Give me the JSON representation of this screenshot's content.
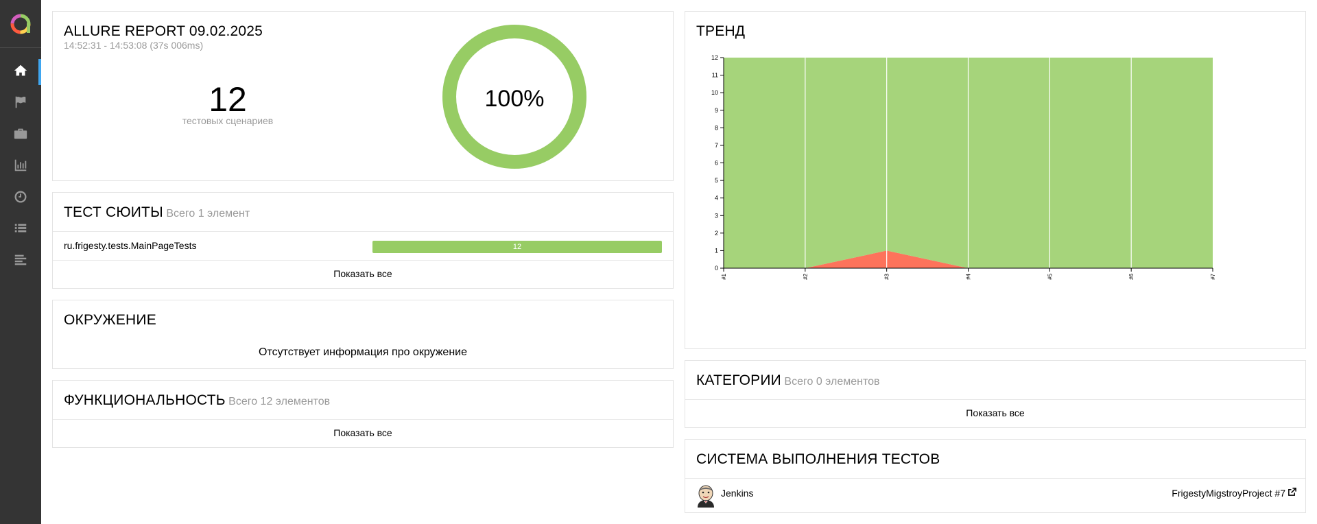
{
  "sidebar": {
    "logo": "allure-logo-icon",
    "items": [
      {
        "icon": "home-icon",
        "active": true
      },
      {
        "icon": "flag-icon",
        "active": false
      },
      {
        "icon": "briefcase-icon",
        "active": false
      },
      {
        "icon": "bar-chart-icon",
        "active": false
      },
      {
        "icon": "clock-icon",
        "active": false
      },
      {
        "icon": "list-icon",
        "active": false
      },
      {
        "icon": "timeline-icon",
        "active": false
      }
    ]
  },
  "summary": {
    "title": "ALLURE REPORT 09.02.2025",
    "time_range": "14:52:31 - 14:53:08 (37s 006ms)",
    "count": "12",
    "count_label": "тестовых сценариев",
    "percent": "100%",
    "passed_fraction": 1.0,
    "ring_color": "#97cc64"
  },
  "suites": {
    "title": "ТЕСТ СЮИТЫ",
    "subtitle": "Всего 1 элемент",
    "rows": [
      {
        "name": "ru.frigesty.tests.MainPageTests",
        "count": "12",
        "passed_fraction": 1.0
      }
    ],
    "show_all": "Показать все"
  },
  "environment": {
    "title": "ОКРУЖЕНИЕ",
    "empty_text": "Отсутствует информация про окружение"
  },
  "features": {
    "title": "ФУНКЦИОНАЛЬНОСТЬ",
    "subtitle": "Всего 12 элементов",
    "show_all": "Показать все"
  },
  "trend": {
    "title": "ТРЕНД"
  },
  "chart_data": {
    "type": "area",
    "x": [
      "#1",
      "#2",
      "#3",
      "#4",
      "#5",
      "#6",
      "#7"
    ],
    "series": [
      {
        "name": "passed",
        "color": "#97cc64",
        "values": [
          12,
          12,
          11,
          12,
          12,
          12,
          12
        ]
      },
      {
        "name": "failed",
        "color": "#fd5a3e",
        "values": [
          0,
          0,
          1,
          0,
          0,
          0,
          0
        ]
      }
    ],
    "yticks": [
      "0",
      "1",
      "2",
      "3",
      "4",
      "5",
      "6",
      "7",
      "8",
      "9",
      "10",
      "11",
      "12"
    ],
    "ylim": [
      0,
      12
    ],
    "grid": true
  },
  "categories": {
    "title": "КАТЕГОРИИ",
    "subtitle": "Всего 0 элементов",
    "show_all": "Показать все"
  },
  "executors": {
    "title": "СИСТЕМА ВЫПОЛНЕНИЯ ТЕСТОВ",
    "name": "Jenkins",
    "build": "FrigestyMigstroyProject #7",
    "avatar_icon": "jenkins-icon",
    "link_icon": "external-link-icon"
  }
}
